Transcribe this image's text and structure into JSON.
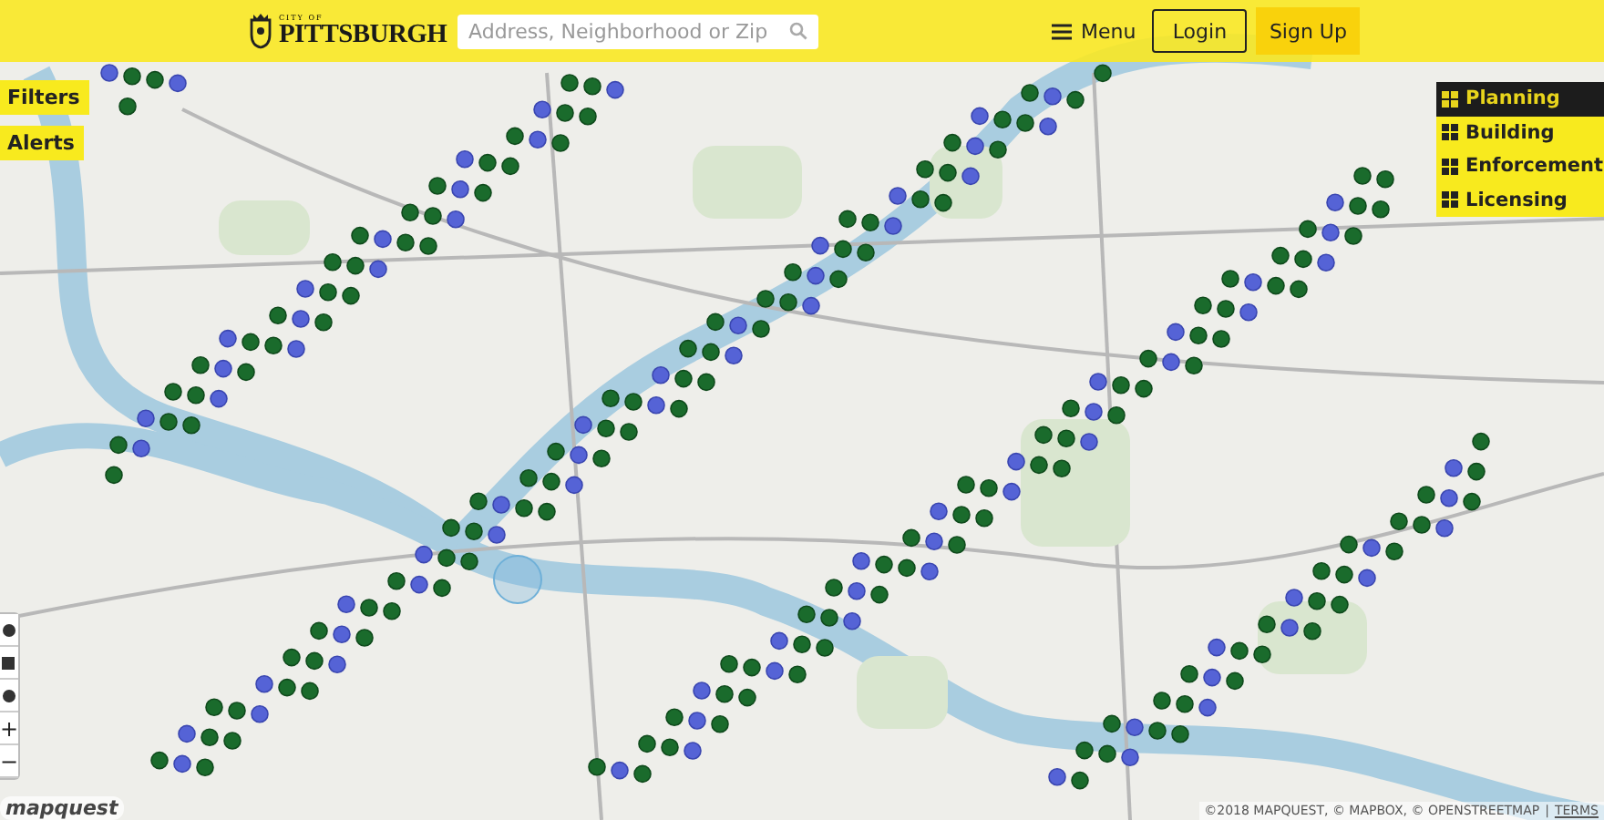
{
  "header": {
    "logo_small": "CITY OF",
    "logo": "PITTSBURGH",
    "search": {
      "placeholder": "Address, Neighborhood or Zip"
    },
    "menu": "Menu",
    "login": "Login",
    "signup": "Sign Up"
  },
  "left_buttons": [
    {
      "label": "Filters"
    },
    {
      "label": "Alerts"
    }
  ],
  "layers": [
    {
      "label": "Planning",
      "selected": true
    },
    {
      "label": "Building",
      "selected": false
    },
    {
      "label": "Enforcement",
      "selected": false
    },
    {
      "label": "Licensing",
      "selected": false
    }
  ],
  "zoom": {
    "in": "+",
    "out": "−"
  },
  "map": {
    "provider_logo": "mapquest",
    "attribution": "©2018 MAPQUEST, © MAPBOX, © OPENSTREETMAP",
    "separator": "|",
    "terms": "TERMS"
  }
}
